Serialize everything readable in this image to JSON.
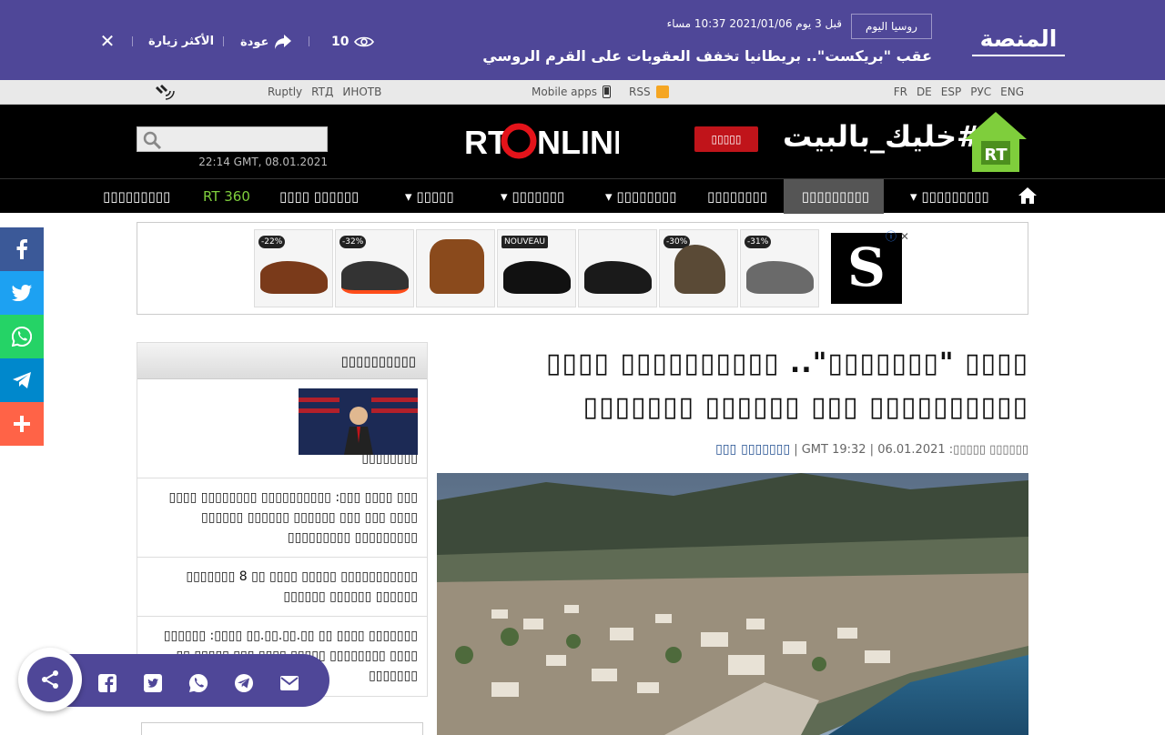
{
  "topbar": {
    "logo_text": "المنصة",
    "source_badge": "روسيا اليوم",
    "timestamp": "قبل 3 يوم 2021/01/06 10:37 مساء",
    "headline": "عقب \"بريكست\".. بريطانيا تخفف العقوبات على القرم الروسي",
    "views": "10",
    "back_label": "عودة",
    "most_visited": "الأكثر زيارة",
    "close_symbol": "✕"
  },
  "utilbar": {
    "languages": [
      "ENG",
      "РУС",
      "ESP",
      "DE",
      "FR"
    ],
    "rss": "RSS",
    "mobile_apps": "Mobile apps",
    "links": [
      "Ruptly",
      "RTД",
      "ИНОТВ"
    ]
  },
  "header": {
    "promo_text": "#خليك_بالبيت",
    "promo_logo": "RT",
    "red_button": "▯▯▯▯▯",
    "logo_left": "RT",
    "logo_right": "NLINE",
    "search_placeholder": "",
    "date": "22:14 GMT, 08.01.2021"
  },
  "nav": {
    "items": [
      {
        "label": "▯▯▯▯▯▯▯▯▯",
        "has_caret": true
      },
      {
        "label": "▯▯▯▯▯▯▯▯▯",
        "active": true
      },
      {
        "label": "▯▯▯▯▯▯▯▯",
        "has_caret": false
      },
      {
        "label": "▯▯▯▯▯▯▯▯",
        "has_caret": true
      },
      {
        "label": "▯▯▯▯▯▯▯",
        "has_caret": true
      },
      {
        "label": "▯▯▯▯▯",
        "has_caret": true
      },
      {
        "label": "▯▯▯▯▯▯ ▯▯▯▯",
        "has_caret": false
      },
      {
        "label": "RT 360",
        "green": true
      },
      {
        "label": "▯▯▯▯▯▯▯▯▯",
        "has_caret": false
      }
    ]
  },
  "ad": {
    "tags": [
      "-22%",
      "-32%",
      "",
      "NOUVEAU",
      "",
      "-30%",
      "-31%"
    ],
    "brand_letter": "S"
  },
  "article": {
    "title_line1": "▯▯▯▯ \"▯▯▯▯▯▯▯\".. ▯▯▯▯▯▯▯▯▯▯ ▯▯▯▯",
    "title_line2": "▯▯▯▯▯▯▯▯▯▯ ▯▯▯ ▯▯▯▯▯▯ ▯▯▯▯▯▯▯",
    "meta_label": "▯▯▯▯▯▯ ▯▯▯▯▯:",
    "date": "06.01.2021",
    "time": "GMT 19:32",
    "section": "▯▯▯▯▯▯▯ ▯▯▯"
  },
  "sidebar": {
    "heading": "▯▯▯▯▯▯▯▯▯▯",
    "items": [
      {
        "text": "▯▯▯▯▯▯ ▯▯▯▯▯▯▯: ▯▯▯▯▯▯▯▯ ▯▯▯▯▯ ▯▯▯▯▯▯ ▯▯ ▯▯▯▯▯▯▯ ▯▯▯▯▯▯▯▯",
        "has_thumb": true
      },
      {
        "text": "▯▯▯ ▯▯▯▯ ▯▯▯: ▯▯▯▯▯▯▯▯▯▯ ▯▯▯▯▯▯▯▯ ▯▯▯▯ ▯▯▯▯ ▯▯▯ ▯▯▯ ▯▯▯▯▯▯ ▯▯▯▯▯▯ ▯▯▯▯▯▯ ▯▯▯▯▯▯▯▯▯ ▯▯▯▯▯▯▯▯▯"
      },
      {
        "text": "▯▯▯▯▯▯▯▯▯▯▯ ▯▯▯▯▯ ▯▯▯▯ ▯▯ 8 ▯▯▯▯▯▯▯ ▯▯▯▯▯▯ ▯▯▯▯▯▯ ▯▯▯▯▯▯"
      },
      {
        "text": "▯▯▯▯▯▯▯ ▯▯▯▯ ▯▯ ▯▯.▯▯.▯▯.▯▯ ▯▯▯▯: ▯▯▯▯▯▯ ▯▯▯▯ ▯▯▯▯▯▯▯▯ ▯▯▯▯▯ ▯▯▯▯ ▯▯▯ ▯▯▯▯▯ ▯▯ ▯▯▯▯▯▯▯"
      }
    ]
  },
  "colors": {
    "brand_purple": "#4f4798",
    "facebook": "#3b5998",
    "twitter": "#1da1f2",
    "whatsapp": "#25d366",
    "telegram": "#0088cc",
    "more": "#ff6347",
    "green_accent": "#7fce3c",
    "red_accent": "#c0141a"
  },
  "icons": [
    "eye-icon",
    "share-arrow-icon",
    "close-icon",
    "rss-icon",
    "phone-icon",
    "satellite-icon",
    "search-icon",
    "home-icon",
    "facebook-icon",
    "twitter-icon",
    "whatsapp-icon",
    "telegram-icon",
    "plus-icon",
    "share-icon",
    "email-icon"
  ]
}
